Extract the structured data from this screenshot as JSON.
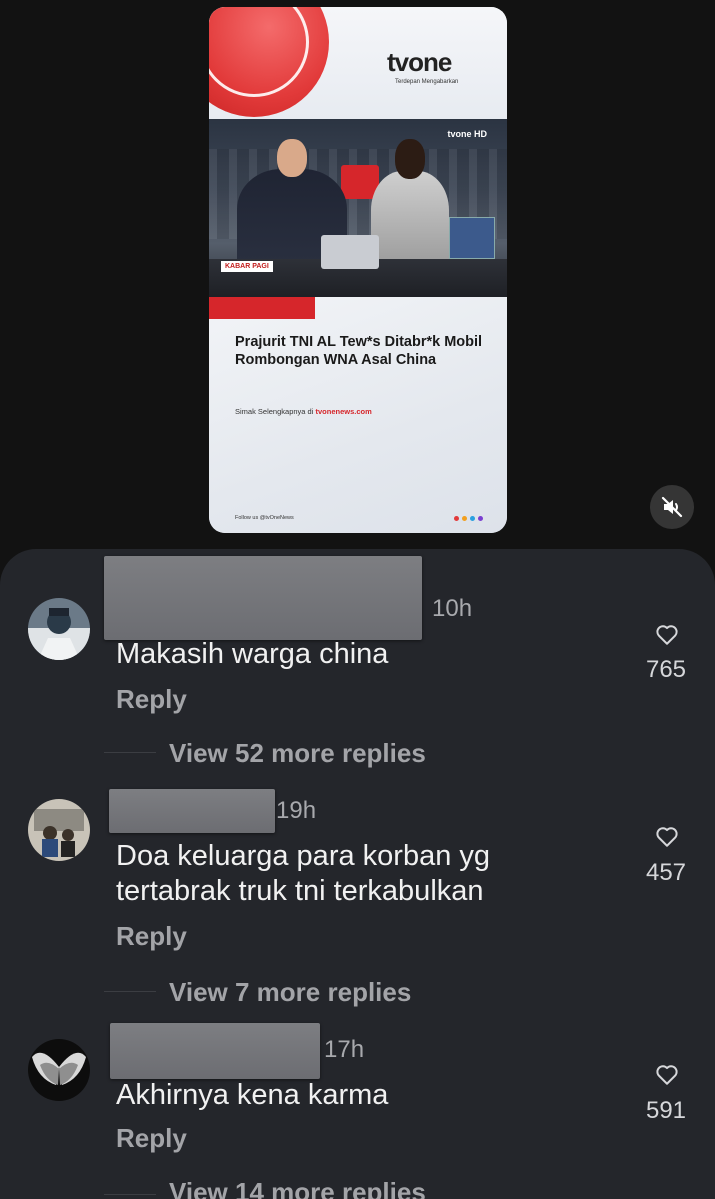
{
  "video": {
    "brand": "tvone",
    "tagline": "Terdepan Mengabarkan",
    "studio_logo": "tvone HD",
    "program_badge": "KABAR PAGI",
    "headline": "Prajurit TNI AL Tew*s Ditabr*k Mobil Rombongan WNA Asal China",
    "simak_prefix": "Simak Selengkapnya di",
    "simak_site": "tvonenews.com",
    "follow_text": "Follow us  @tvOneNews",
    "mute_icon": "speaker-muted-icon"
  },
  "comments": [
    {
      "time": "10h",
      "text": "Makasih warga china",
      "reply_label": "Reply",
      "likes": "765",
      "view_more": "View 52 more replies"
    },
    {
      "time": "19h",
      "text": "Doa keluarga para korban yg tertabrak truk tni terkabulkan",
      "reply_label": "Reply",
      "likes": "457",
      "view_more": "View 7 more replies"
    },
    {
      "time": "17h",
      "text": "Akhirnya kena karma",
      "reply_label": "Reply",
      "likes": "591",
      "view_more": "View 14 more replies"
    }
  ],
  "colors": {
    "background": "#121212",
    "sheet": "#24262b",
    "accent_red": "#d6262b"
  }
}
